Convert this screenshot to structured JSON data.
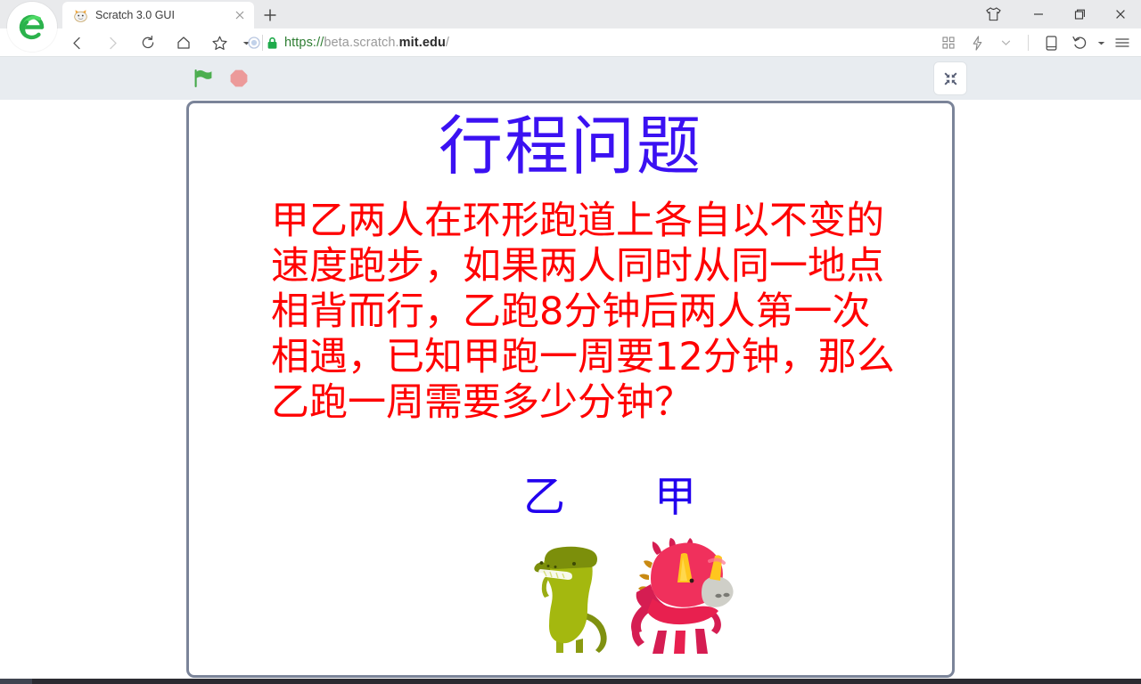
{
  "browser": {
    "logo_icon": "green-e-browser-logo",
    "tab": {
      "favicon": "scratch-cat-icon",
      "title": "Scratch 3.0 GUI",
      "close_icon": "close-icon"
    },
    "new_tab_icon": "plus-icon",
    "window_controls": {
      "tshirt_icon": "tshirt-skin-icon",
      "minimize_icon": "minimize-icon",
      "maximize_icon": "maximize-icon",
      "close_icon": "close-icon"
    },
    "nav": {
      "back_icon": "chevron-left-icon",
      "forward_icon": "chevron-right-icon",
      "reload_icon": "reload-icon",
      "home_icon": "home-icon",
      "bookmark_icon": "star-icon",
      "bookmark_dropdown_icon": "caret-down-icon"
    },
    "address": {
      "page_info_icon": "page-info-icon",
      "lock_icon": "lock-icon",
      "scheme": "https://",
      "subdomain": "beta.scratch.",
      "domain": "mit.edu",
      "path": "/",
      "full_url": "https://beta.scratch.mit.edu/"
    },
    "right_tools": {
      "qr_icon": "qr-code-icon",
      "speed_icon": "lightning-icon",
      "chevron_icon": "chevron-down-icon",
      "mobile_icon": "mobile-view-icon",
      "history_icon": "undo-history-icon",
      "history_caret_icon": "caret-down-icon",
      "menu_icon": "hamburger-menu-icon"
    }
  },
  "scratch_toolbar": {
    "green_flag_icon": "green-flag-icon",
    "stop_icon": "stop-sign-icon",
    "fullscreen_icon": "exit-fullscreen-icon"
  },
  "stage": {
    "title": "行程问题",
    "title_color": "#3b11f2",
    "body_color": "#ff0000",
    "body_lines": [
      "甲乙两人在环形跑道上各自以不变的",
      "速度跑步，如果两人同时从同一地点",
      "相背而行，乙跑8分钟后两人第一次",
      "相遇，已知甲跑一周要12分钟，那么",
      "乙跑一周需要多少分钟？"
    ],
    "sprites": [
      {
        "label": "乙",
        "label_color": "#2200ee",
        "icon": "green-dinosaur-sprite"
      },
      {
        "label": "甲",
        "label_color": "#2200ee",
        "icon": "red-dinosaur-sprite"
      }
    ]
  }
}
